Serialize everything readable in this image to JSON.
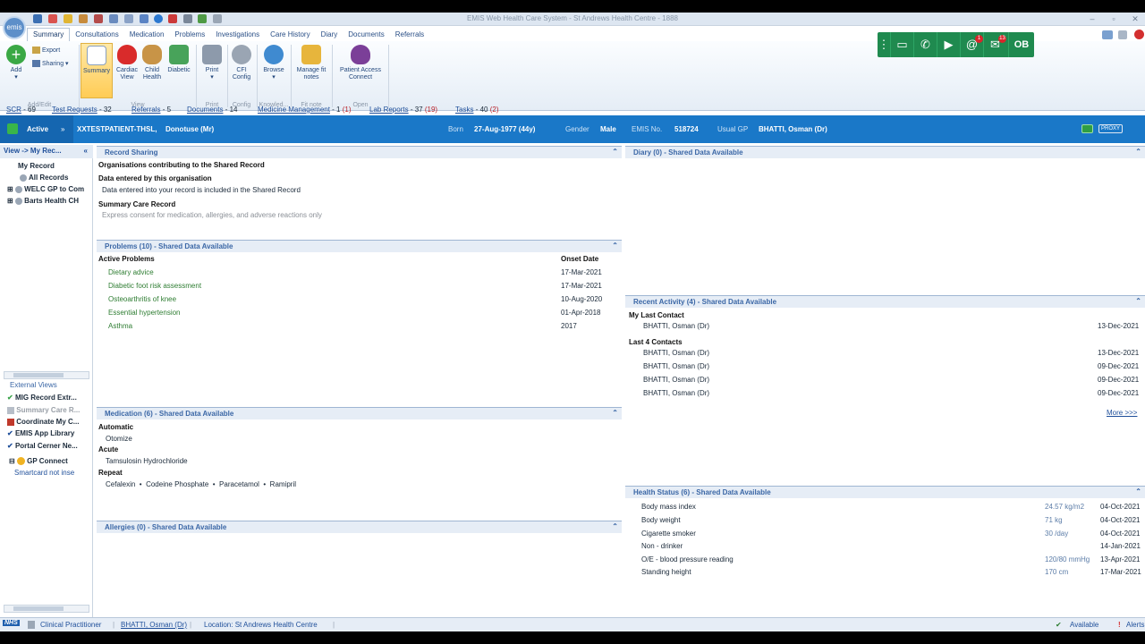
{
  "window": {
    "title": "EMIS Web Health Care System - St Andrews Health Centre - 1888",
    "logo_text": "emis"
  },
  "ribbon_tabs": [
    "Summary",
    "Consultations",
    "Medication",
    "Problems",
    "Investigations",
    "Care History",
    "Diary",
    "Documents",
    "Referrals"
  ],
  "ribbon": {
    "add": "Add",
    "export": "Export",
    "sharing": "Sharing",
    "add_edit_group": "Add/Edit",
    "summary": "Summary",
    "cardiac_view": "Cardiac View",
    "child_health": "Child Health",
    "diabetic": "Diabetic",
    "view_group": "View",
    "print": "Print",
    "print_group": "Print",
    "cfi_config": "CFI Config",
    "config_group": "Config",
    "browse": "Browse",
    "knowledge_group": "Knowled...",
    "manage_fit_notes": "Manage fit notes",
    "fit_note_group": "Fit note",
    "patient_access_connect": "Patient Access Connect",
    "open_group": "Open"
  },
  "callbar": {
    "initials": "OB",
    "mention_badge": "1",
    "mail_badge": "13"
  },
  "links": [
    {
      "label": "SCR",
      "count": "- 69",
      "red": ""
    },
    {
      "label": "Test Requests",
      "count": "- 32",
      "red": ""
    },
    {
      "label": "Referrals",
      "count": "- 5",
      "red": ""
    },
    {
      "label": "Documents",
      "count": "- 14",
      "red": ""
    },
    {
      "label": "Medicine Management",
      "count": "- 1",
      "red": "(1)"
    },
    {
      "label": "Lab Reports",
      "count": "- 37",
      "red": "(19)"
    },
    {
      "label": "Tasks",
      "count": "- 40",
      "red": "(2)"
    }
  ],
  "patient": {
    "status": "Active",
    "name": "XXTESTPATIENT-THSL,",
    "given": "Donotuse (Mr)",
    "born_label": "Born",
    "born": "27-Aug-1977 (44y)",
    "gender_label": "Gender",
    "gender": "Male",
    "emis_label": "EMIS No.",
    "emis_no": "518724",
    "gp_label": "Usual GP",
    "gp": "BHATTI, Osman (Dr)",
    "badge": "PROXY"
  },
  "left": {
    "header": "View -> My Rec...",
    "tree": [
      "My Record",
      "All Records",
      "WELC GP to Com",
      "Barts Health CH"
    ],
    "external_label": "External Views",
    "external": [
      "MIG Record Extr...",
      "Summary Care R...",
      "Coordinate My C...",
      "EMIS App Library",
      "Portal Cerner Ne..."
    ],
    "gp_connect": "GP Connect",
    "smartcard": "Smartcard not inse"
  },
  "record_sharing": {
    "header": "Record Sharing",
    "line1": "Organisations contributing to the Shared Record",
    "line2": "Data entered by this organisation",
    "line3": "Data entered into your record is included in the Shared Record",
    "line4": "Summary Care Record",
    "line5": "Express consent for medication, allergies, and adverse reactions only"
  },
  "problems": {
    "header": "Problems (10) - Shared Data Available",
    "col1": "Active Problems",
    "col2": "Onset Date",
    "rows": [
      {
        "name": "Dietary advice",
        "date": "17-Mar-2021"
      },
      {
        "name": "Diabetic foot risk assessment",
        "date": "17-Mar-2021"
      },
      {
        "name": "Osteoarthritis of knee",
        "date": "10-Aug-2020"
      },
      {
        "name": "Essential hypertension",
        "date": "01-Apr-2018"
      },
      {
        "name": "Asthma",
        "date": "2017"
      }
    ]
  },
  "medication": {
    "header": "Medication (6) - Shared Data Available",
    "automatic": "Automatic",
    "automatic_items": "Otomize",
    "acute": "Acute",
    "acute_items": "Tamsulosin Hydrochloride",
    "repeat": "Repeat",
    "repeat_items": [
      "Cefalexin",
      "Codeine Phosphate",
      "Paracetamol",
      "Ramipril"
    ]
  },
  "allergies": {
    "header": "Allergies (0) - Shared Data Available"
  },
  "diary": {
    "header": "Diary (0) - Shared Data Available"
  },
  "recent": {
    "header": "Recent Activity (4) - Shared Data Available",
    "last_contact_label": "My Last Contact",
    "last_contact": {
      "name": "BHATTI, Osman (Dr)",
      "date": "13-Dec-2021"
    },
    "last4_label": "Last 4 Contacts",
    "contacts": [
      {
        "name": "BHATTI, Osman (Dr)",
        "date": "13-Dec-2021"
      },
      {
        "name": "BHATTI, Osman (Dr)",
        "date": "09-Dec-2021"
      },
      {
        "name": "BHATTI, Osman (Dr)",
        "date": "09-Dec-2021"
      },
      {
        "name": "BHATTI, Osman (Dr)",
        "date": "09-Dec-2021"
      }
    ],
    "more": "More >>>"
  },
  "health": {
    "header": "Health Status (6) - Shared Data Available",
    "rows": [
      {
        "name": "Body mass index",
        "value": "24.57 kg/m2",
        "date": "04-Oct-2021"
      },
      {
        "name": "Body weight",
        "value": "71 kg",
        "date": "04-Oct-2021"
      },
      {
        "name": "Cigarette smoker",
        "value": "30 /day",
        "date": "04-Oct-2021"
      },
      {
        "name": "Non - drinker",
        "value": "",
        "date": "14-Jan-2021"
      },
      {
        "name": "O/E - blood pressure reading",
        "value": "120/80 mmHg",
        "date": "13-Apr-2021"
      },
      {
        "name": "Standing height",
        "value": "170 cm",
        "date": "17-Mar-2021"
      }
    ]
  },
  "status": {
    "nhs": "NHS",
    "role": "Clinical Practitioner",
    "user": "BHATTI, Osman (Dr)",
    "location": "Location:  St Andrews Health Centre",
    "available": "Available",
    "alerts": "Alerts"
  }
}
